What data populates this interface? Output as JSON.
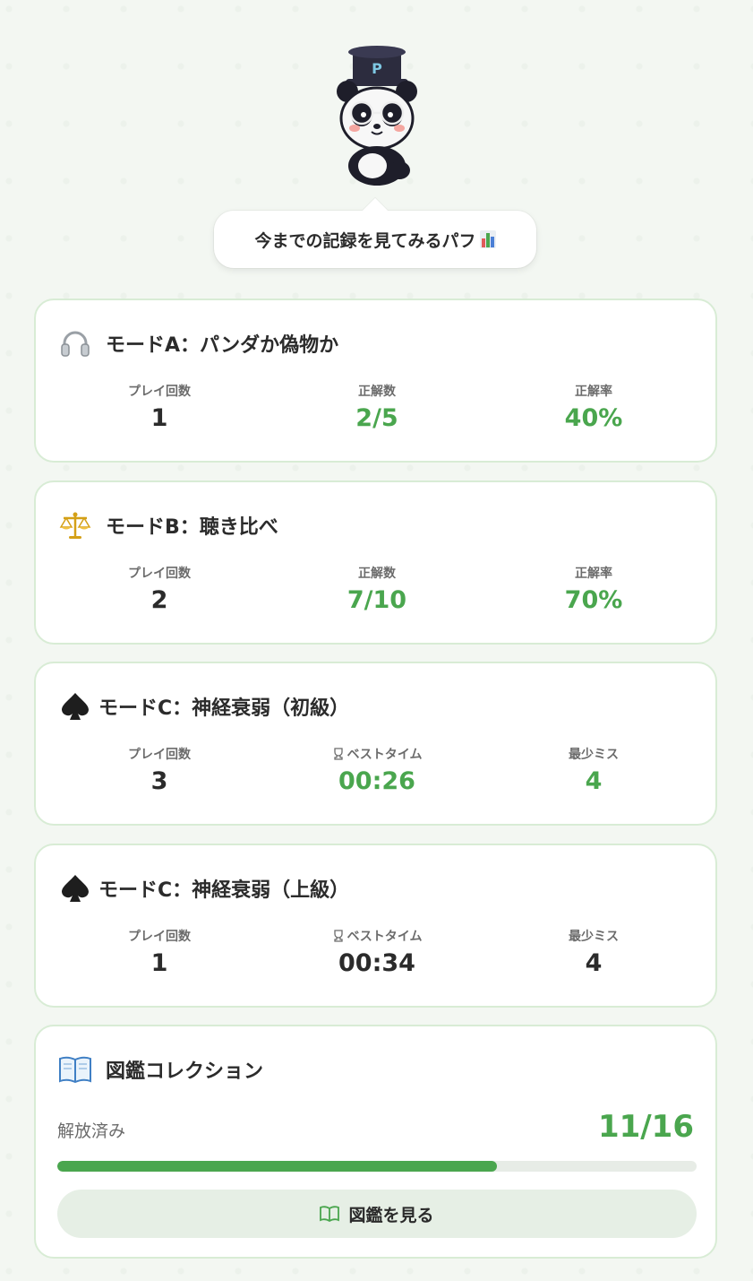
{
  "bubble": {
    "text": "今までの記録を見てみるパフ",
    "chart_emoji": "bar-chart-emoji"
  },
  "colors": {
    "accent": "#4aa64e",
    "card_border": "#d8ecd5",
    "background": "#f3f7f2"
  },
  "modes": [
    {
      "icon": "headphones-icon",
      "title": "モードA：パンダか偽物か",
      "stats": [
        {
          "label": "プレイ回数",
          "value": "1"
        },
        {
          "label": "正解数",
          "value": "2/5"
        },
        {
          "label": "正解率",
          "value": "40%"
        }
      ]
    },
    {
      "icon": "scales-icon",
      "title": "モードB：聴き比べ",
      "stats": [
        {
          "label": "プレイ回数",
          "value": "2"
        },
        {
          "label": "正解数",
          "value": "7/10"
        },
        {
          "label": "正解率",
          "value": "70%"
        }
      ]
    },
    {
      "icon": "spade-icon",
      "title": "モードC：神経衰弱（初級）",
      "stats": [
        {
          "label": "プレイ回数",
          "value": "3"
        },
        {
          "label": "ベストタイム",
          "value": "00:26"
        },
        {
          "label": "最少ミス",
          "value": "4"
        }
      ]
    },
    {
      "icon": "spade-icon",
      "title": "モードC：神経衰弱（上級）",
      "stats": [
        {
          "label": "プレイ回数",
          "value": "1"
        },
        {
          "label": "ベストタイム",
          "value": "00:34"
        },
        {
          "label": "最少ミス",
          "value": "4"
        }
      ]
    }
  ],
  "collection": {
    "icon": "book-icon",
    "title": "図鑑コレクション",
    "unlocked_label": "解放済み",
    "unlocked_value": "11/16",
    "progress_fraction": 0.6875,
    "button_label": "図鑑を見る"
  }
}
